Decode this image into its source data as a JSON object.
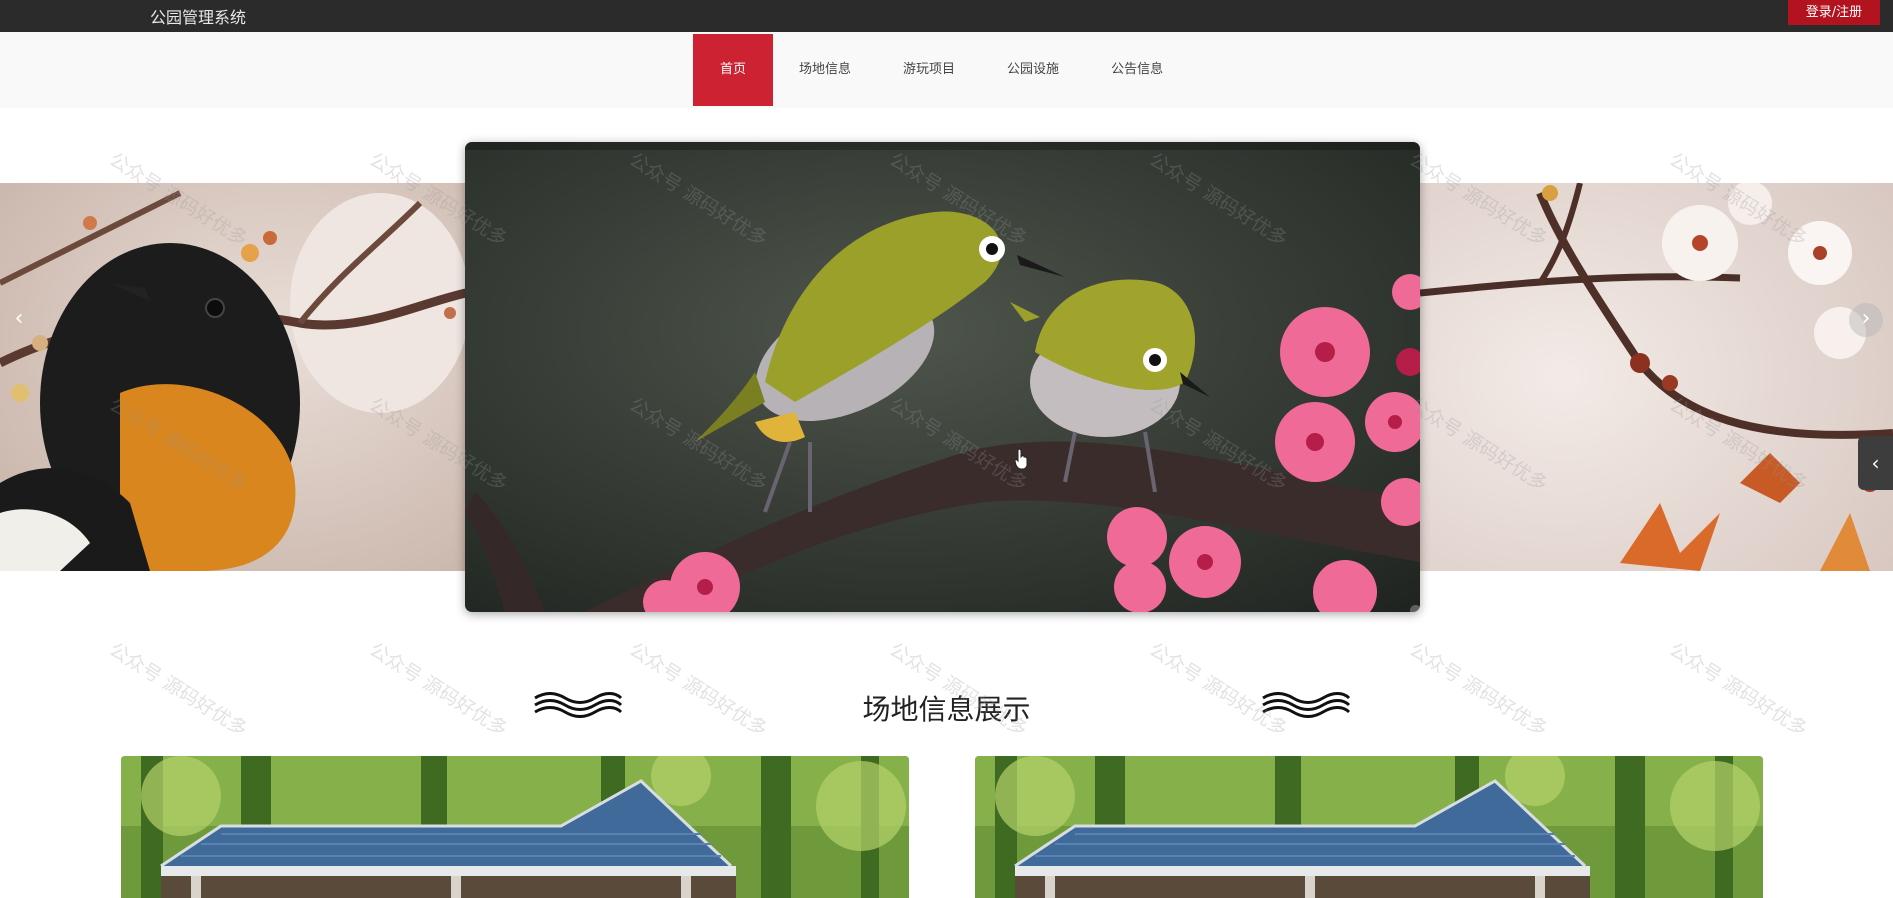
{
  "header": {
    "site_title": "公园管理系统",
    "login_label": "登录/注册"
  },
  "nav": {
    "items": [
      {
        "label": "首页",
        "active": true
      },
      {
        "label": "场地信息",
        "active": false
      },
      {
        "label": "游玩项目",
        "active": false
      },
      {
        "label": "公园设施",
        "active": false
      },
      {
        "label": "公告信息",
        "active": false
      }
    ]
  },
  "carousel": {
    "slide_count": 3,
    "active_index": 2,
    "prev_icon": "chevron-left-icon",
    "next_icon": "chevron-right-icon",
    "side_tab_icon": "chevron-left-icon"
  },
  "section": {
    "title": "场地信息展示"
  },
  "watermark": "公众号 源码好优多",
  "colors": {
    "accent": "#cd2232",
    "topbar": "#2b2b2b",
    "login": "#b3121f"
  }
}
